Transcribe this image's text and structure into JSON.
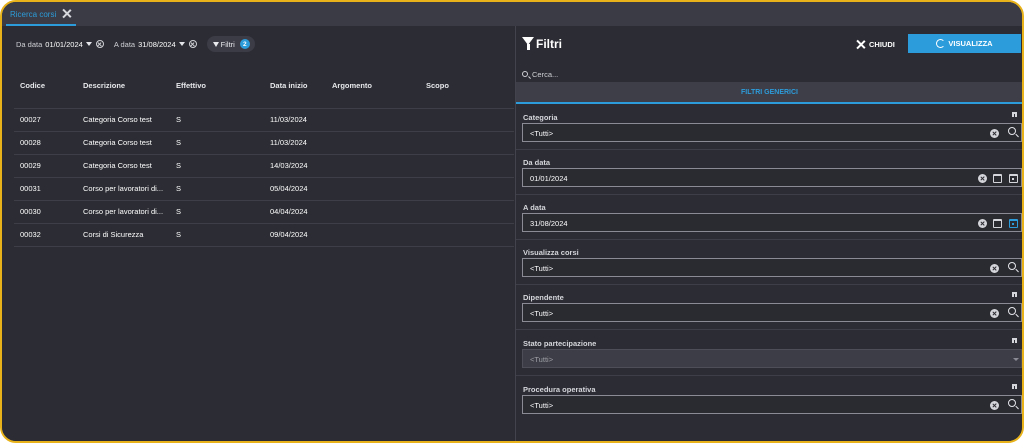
{
  "tab": {
    "label": "Ricerca corsi"
  },
  "filterbar": {
    "from": {
      "label": "Da data",
      "value": "01/01/2024"
    },
    "to": {
      "label": "A data",
      "value": "31/08/2024"
    },
    "filters": {
      "label": "Filtri",
      "count": "2"
    }
  },
  "table": {
    "headers": [
      "Codice",
      "Descrizione",
      "Effettivo",
      "Data inizio",
      "Argomento",
      "Scopo"
    ],
    "rows": [
      [
        "00027",
        "Categoria Corso test",
        "S",
        "11/03/2024",
        "",
        ""
      ],
      [
        "00028",
        "Categoria Corso test",
        "S",
        "11/03/2024",
        "",
        ""
      ],
      [
        "00029",
        "Categoria Corso test",
        "S",
        "14/03/2024",
        "",
        ""
      ],
      [
        "00031",
        "Corso per lavoratori di...",
        "S",
        "05/04/2024",
        "",
        ""
      ],
      [
        "00030",
        "Corso per lavoratori di...",
        "S",
        "04/04/2024",
        "",
        ""
      ],
      [
        "00032",
        "Corsi di Sicurezza",
        "S",
        "09/04/2024",
        "",
        ""
      ]
    ]
  },
  "panel": {
    "title": "Filtri",
    "close_label": "CHIUDI",
    "show_label": "VISUALIZZA",
    "search_placeholder": "Cerca...",
    "section_label": "FILTRI GENERICI",
    "accent": "#2d9cdb",
    "fields": [
      {
        "label": "Categoria",
        "value": "<Tutti>",
        "kind": "lookup",
        "multi": true
      },
      {
        "label": "Da data",
        "value": "01/01/2024",
        "kind": "date"
      },
      {
        "label": "A data",
        "value": "31/08/2024",
        "kind": "date",
        "active": true
      },
      {
        "label": "Visualizza corsi",
        "value": "<Tutti>",
        "kind": "lookup"
      },
      {
        "label": "Dipendente",
        "value": "<Tutti>",
        "kind": "lookup",
        "multi": true
      },
      {
        "label": "Stato partecipazione",
        "value": "<Tutti>",
        "kind": "select",
        "disabled": true,
        "multi": true
      },
      {
        "label": "Procedura operativa",
        "value": "<Tutti>",
        "kind": "lookup",
        "multi": true
      }
    ]
  }
}
